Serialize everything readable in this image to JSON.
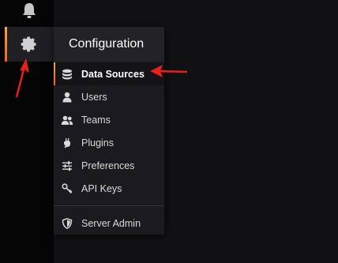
{
  "menu": {
    "title": "Configuration",
    "items": [
      {
        "label": "Data Sources",
        "icon": "database-icon",
        "active": true
      },
      {
        "label": "Users",
        "icon": "user-icon"
      },
      {
        "label": "Teams",
        "icon": "users-icon"
      },
      {
        "label": "Plugins",
        "icon": "plug-icon"
      },
      {
        "label": "Preferences",
        "icon": "sliders-icon"
      },
      {
        "label": "API Keys",
        "icon": "key-icon"
      }
    ],
    "admin": {
      "label": "Server Admin",
      "icon": "shield-icon"
    }
  },
  "colors": {
    "accent": "#e8661e",
    "annotation": "#e8211a"
  }
}
